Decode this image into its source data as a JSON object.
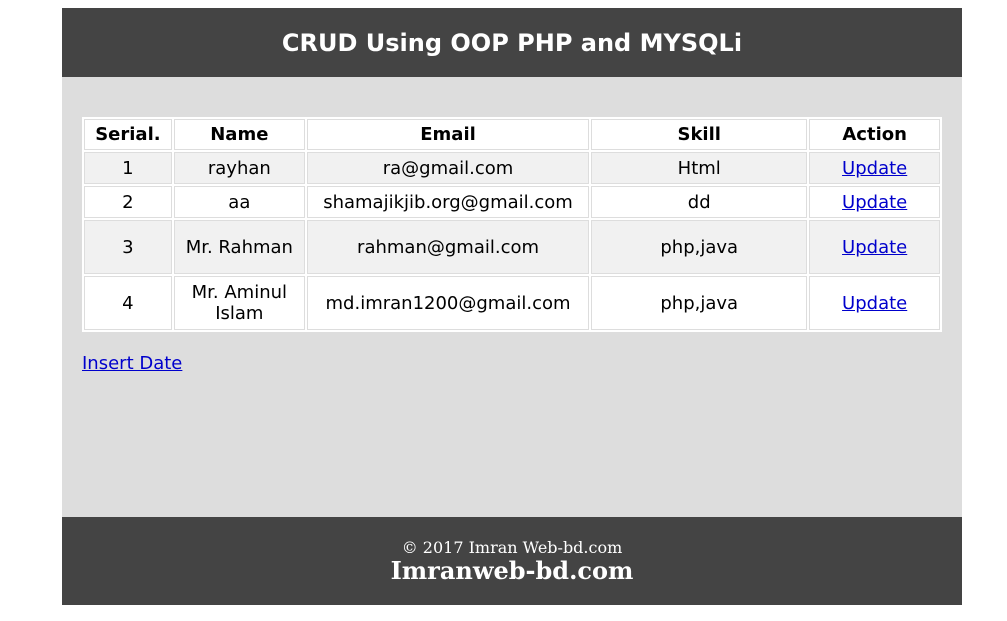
{
  "header": {
    "title": "CRUD Using OOP PHP and MYSQLi"
  },
  "table": {
    "columns": [
      "Serial.",
      "Name",
      "Email",
      "Skill",
      "Action"
    ],
    "rows": [
      {
        "serial": "1",
        "name": "rayhan",
        "email": "ra@gmail.com",
        "skill": "Html",
        "action": "Update"
      },
      {
        "serial": "2",
        "name": "aa",
        "email": "shamajikjib.org@gmail.com",
        "skill": "dd",
        "action": "Update"
      },
      {
        "serial": "3",
        "name": "Mr. Rahman",
        "email": "rahman@gmail.com",
        "skill": "php,java",
        "action": "Update"
      },
      {
        "serial": "4",
        "name": "Mr. Aminul Islam",
        "email": "md.imran1200@gmail.com",
        "skill": "php,java",
        "action": "Update"
      }
    ]
  },
  "insert_link": "Insert Date",
  "footer": {
    "copyright": "© 2017 Imran Web-bd.com",
    "brand": "Imranweb-bd.com"
  },
  "colors": {
    "header_bg": "#444444",
    "page_bg": "#dddddd",
    "link": "#0000cc"
  }
}
